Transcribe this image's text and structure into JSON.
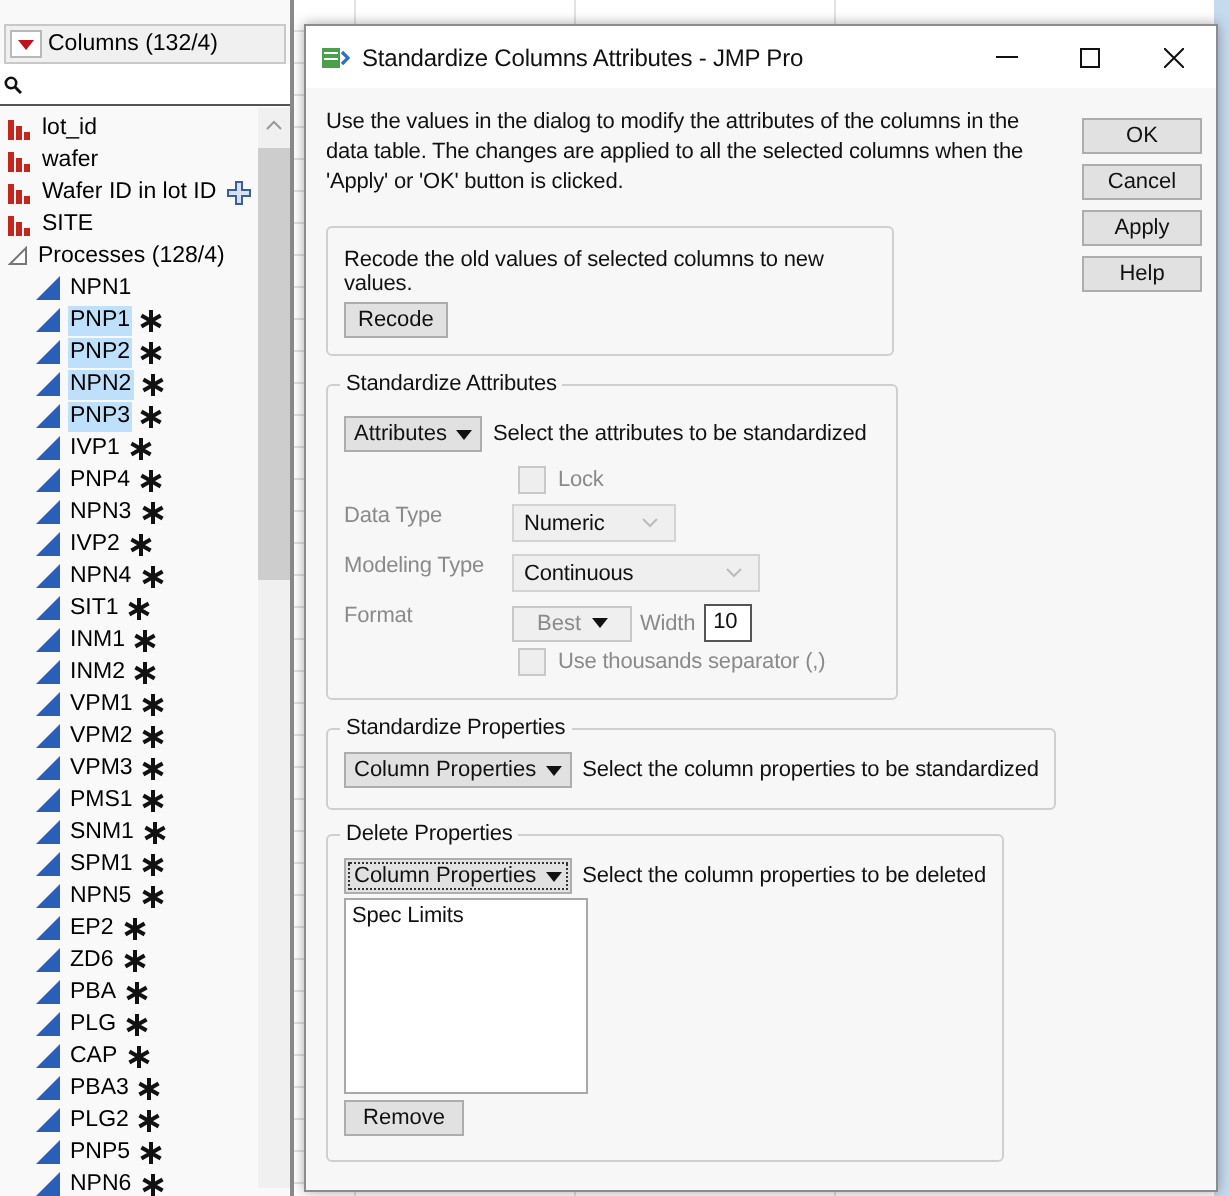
{
  "columns_panel": {
    "title": "Columns (132/4)",
    "items": [
      {
        "name": "lot_id",
        "kind": "nominal",
        "selected": false,
        "linked": false
      },
      {
        "name": "wafer",
        "kind": "nominal",
        "selected": false,
        "linked": false
      },
      {
        "name": "Wafer ID in lot ID",
        "kind": "nominal",
        "selected": false,
        "linked": true
      },
      {
        "name": "SITE",
        "kind": "nominal",
        "selected": false,
        "linked": false
      },
      {
        "name": "Processes (128/4)",
        "kind": "group",
        "expanded": true,
        "children": [
          {
            "name": "NPN1",
            "kind": "continuous",
            "selected": false,
            "has_properties": false
          },
          {
            "name": "PNP1",
            "kind": "continuous",
            "selected": true,
            "has_properties": true
          },
          {
            "name": "PNP2",
            "kind": "continuous",
            "selected": true,
            "has_properties": true
          },
          {
            "name": "NPN2",
            "kind": "continuous",
            "selected": true,
            "has_properties": true
          },
          {
            "name": "PNP3",
            "kind": "continuous",
            "selected": true,
            "has_properties": true
          },
          {
            "name": "IVP1",
            "kind": "continuous",
            "selected": false,
            "has_properties": true
          },
          {
            "name": "PNP4",
            "kind": "continuous",
            "selected": false,
            "has_properties": true
          },
          {
            "name": "NPN3",
            "kind": "continuous",
            "selected": false,
            "has_properties": true
          },
          {
            "name": "IVP2",
            "kind": "continuous",
            "selected": false,
            "has_properties": true
          },
          {
            "name": "NPN4",
            "kind": "continuous",
            "selected": false,
            "has_properties": true
          },
          {
            "name": "SIT1",
            "kind": "continuous",
            "selected": false,
            "has_properties": true
          },
          {
            "name": "INM1",
            "kind": "continuous",
            "selected": false,
            "has_properties": true
          },
          {
            "name": "INM2",
            "kind": "continuous",
            "selected": false,
            "has_properties": true
          },
          {
            "name": "VPM1",
            "kind": "continuous",
            "selected": false,
            "has_properties": true
          },
          {
            "name": "VPM2",
            "kind": "continuous",
            "selected": false,
            "has_properties": true
          },
          {
            "name": "VPM3",
            "kind": "continuous",
            "selected": false,
            "has_properties": true
          },
          {
            "name": "PMS1",
            "kind": "continuous",
            "selected": false,
            "has_properties": true
          },
          {
            "name": "SNM1",
            "kind": "continuous",
            "selected": false,
            "has_properties": true
          },
          {
            "name": "SPM1",
            "kind": "continuous",
            "selected": false,
            "has_properties": true
          },
          {
            "name": "NPN5",
            "kind": "continuous",
            "selected": false,
            "has_properties": true
          },
          {
            "name": "EP2",
            "kind": "continuous",
            "selected": false,
            "has_properties": true
          },
          {
            "name": "ZD6",
            "kind": "continuous",
            "selected": false,
            "has_properties": true
          },
          {
            "name": "PBA",
            "kind": "continuous",
            "selected": false,
            "has_properties": true
          },
          {
            "name": "PLG",
            "kind": "continuous",
            "selected": false,
            "has_properties": true
          },
          {
            "name": "CAP",
            "kind": "continuous",
            "selected": false,
            "has_properties": true
          },
          {
            "name": "PBA3",
            "kind": "continuous",
            "selected": false,
            "has_properties": true
          },
          {
            "name": "PLG2",
            "kind": "continuous",
            "selected": false,
            "has_properties": true
          },
          {
            "name": "PNP5",
            "kind": "continuous",
            "selected": false,
            "has_properties": true
          },
          {
            "name": "NPN6",
            "kind": "continuous",
            "selected": false,
            "has_properties": true
          }
        ]
      }
    ]
  },
  "dialog": {
    "title": "Standardize Columns Attributes - JMP Pro",
    "description": "Use the values in the dialog to modify the attributes of the columns in the data table. The changes are applied to all the selected columns when the 'Apply' or 'OK' button is clicked.",
    "buttons": [
      "OK",
      "Cancel",
      "Apply",
      "Help"
    ],
    "recode": {
      "text": "Recode the old values of selected columns to new values.",
      "button": "Recode"
    },
    "attributes": {
      "title": "Standardize Attributes",
      "dropdown": "Attributes",
      "hint": "Select the attributes to be standardized",
      "lock": {
        "label": "Lock",
        "checked": false,
        "disabled": true
      },
      "data_type": {
        "label": "Data Type",
        "value": "Numeric",
        "disabled": true
      },
      "modeling_type": {
        "label": "Modeling Type",
        "value": "Continuous",
        "disabled": true
      },
      "format": {
        "label": "Format",
        "value": "Best",
        "width_label": "Width",
        "width_value": "10",
        "disabled": true
      },
      "thousands": {
        "label": "Use thousands separator (,)",
        "checked": false,
        "disabled": true
      }
    },
    "standardize_properties": {
      "title": "Standardize Properties",
      "dropdown": "Column Properties",
      "hint": "Select the column properties to be standardized"
    },
    "delete_properties": {
      "title": "Delete Properties",
      "dropdown": "Column Properties",
      "hint": "Select the column properties to be deleted",
      "list": [
        "Spec Limits"
      ],
      "button": "Remove"
    }
  }
}
